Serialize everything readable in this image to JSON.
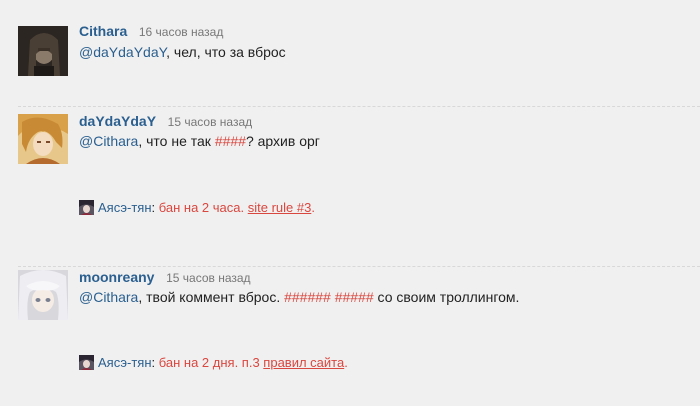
{
  "comments": [
    {
      "author": "Cithara",
      "time": "16 часов назад",
      "mention": "@daYdaYdaY",
      "text_after_mention": ", чел, что за вброс"
    },
    {
      "author": "daYdaYdaY",
      "time": "15 часов назад",
      "mention": "@Cithara",
      "text_part1": ", что не так ",
      "censored": "####",
      "text_part2": "? архив орг",
      "moderation": {
        "moderator": "Аясэ-тян",
        "separator": ": ",
        "ban_text": "бан на 2 часа. ",
        "link_text": "site rule #3",
        "after_link": "."
      }
    },
    {
      "author": "moonreany",
      "time": "15 часов назад",
      "mention": "@Cithara",
      "text_part1": ", твой коммент вброс. ",
      "censored": "###### #####",
      "text_part2": " со своим троллингом.",
      "moderation": {
        "moderator": "Аясэ-тян",
        "separator": ": ",
        "ban_text": "бан на 2 дня. п.3 ",
        "link_text": "правил сайта",
        "after_link": "."
      }
    }
  ]
}
